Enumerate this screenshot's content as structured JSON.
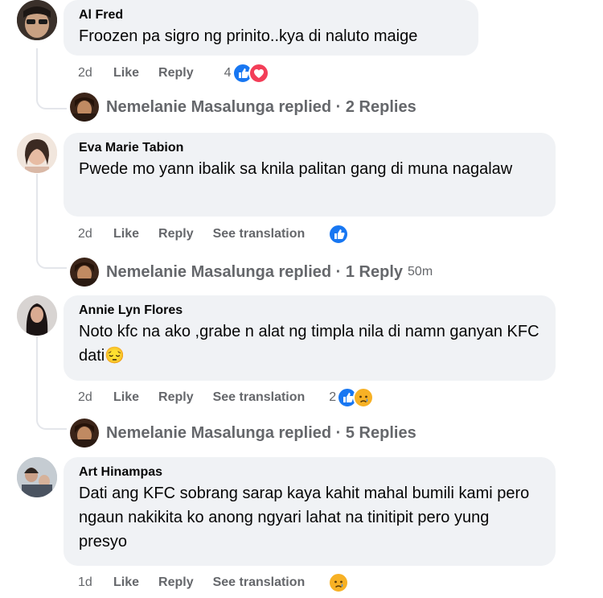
{
  "comments": [
    {
      "author": "Al Fred",
      "text": "Froozen pa sigro ng prinito..kya di naluto maige",
      "time": "2d",
      "like": "Like",
      "reply": "Reply",
      "reaction_count": "4",
      "reactions": [
        "like-icon",
        "love-icon"
      ],
      "reply_summary": "Nemelanie Masalunga replied · 2 Replies",
      "reply_time": ""
    },
    {
      "author": "Eva Marie Tabion",
      "text": "Pwede mo yann ibalik sa knila palitan gang di muna nagalaw",
      "time": "2d",
      "like": "Like",
      "reply": "Reply",
      "translate": "See translation",
      "reaction_count": "",
      "reactions": [
        "like-icon"
      ],
      "reply_summary": "Nemelanie Masalunga replied · 1 Reply",
      "reply_time": "50m"
    },
    {
      "author": "Annie Lyn Flores",
      "text": "Noto kfc na ako ,grabe n alat ng timpla nila di namn ganyan KFC dati😔",
      "time": "2d",
      "like": "Like",
      "reply": "Reply",
      "translate": "See translation",
      "reaction_count": "2",
      "reactions": [
        "like-icon",
        "sad-icon"
      ],
      "reply_summary": "Nemelanie Masalunga replied · 5 Replies",
      "reply_time": ""
    },
    {
      "author": "Art Hinampas",
      "text": "Dati ang KFC sobrang sarap kaya kahit mahal bumili kami pero ngaun nakikita ko anong ngyari lahat na tinitipit pero yung presyo",
      "time": "1d",
      "like": "Like",
      "reply": "Reply",
      "translate": "See translation",
      "reaction_count": "",
      "reactions": [
        "sad-icon"
      ]
    }
  ],
  "colors": {
    "bubble": "#f0f2f5",
    "meta": "#65676b",
    "like_blue": "#1877f2",
    "love_red": "#f33e58",
    "sad_yellow": "#f7b125"
  }
}
